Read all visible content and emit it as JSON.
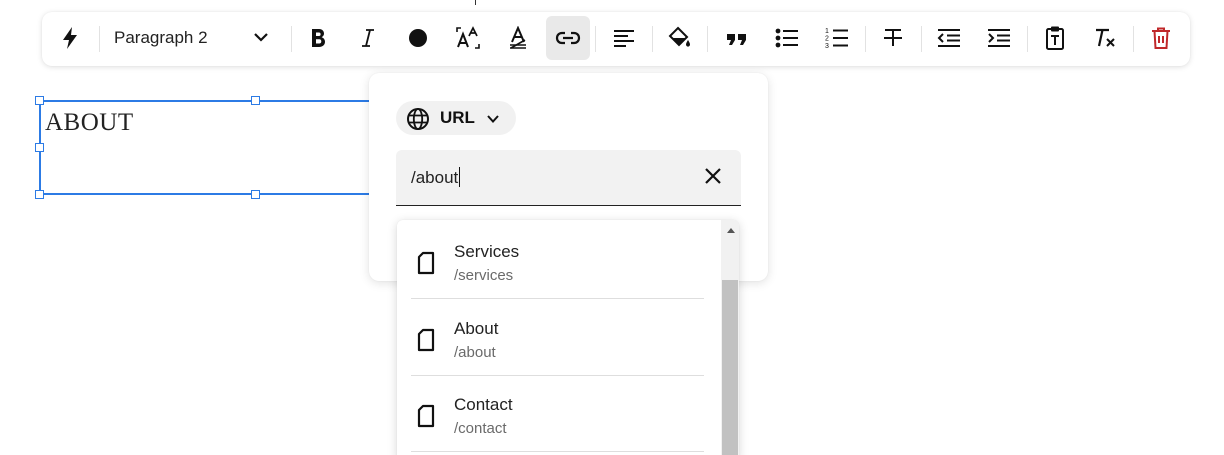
{
  "toolbar": {
    "text_style": "Paragraph 2",
    "icons": [
      "lightning-icon",
      "chevron-down-icon",
      "bold-icon",
      "italic-icon",
      "text-color-icon",
      "text-size-icon",
      "text-clear-color-icon",
      "link-icon",
      "align-left-icon",
      "highlight-icon",
      "quote-icon",
      "bullet-list-icon",
      "numbered-list-icon",
      "strikethrough-icon",
      "outdent-icon",
      "indent-icon",
      "paste-text-icon",
      "clear-formatting-icon",
      "delete-icon"
    ],
    "active_tool": "link",
    "colors": {
      "active_bg": "#e9e9e9",
      "delete": "#c0282a"
    }
  },
  "canvas": {
    "text_block": "ABOUT",
    "selection_color": "#2c7be5"
  },
  "link_popover": {
    "link_type": "URL",
    "url_value": "/about",
    "suggestions": [
      {
        "title": "Services",
        "path": "/services"
      },
      {
        "title": "About",
        "path": "/about"
      },
      {
        "title": "Contact",
        "path": "/contact"
      }
    ]
  }
}
